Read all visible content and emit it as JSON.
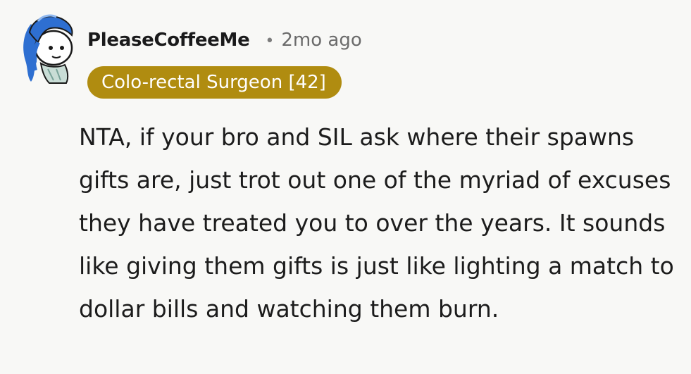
{
  "comment": {
    "username": "PleaseCoffeeMe",
    "separator": "•",
    "timestamp": "2mo ago",
    "flair": "Colo-rectal Surgeon [42]",
    "body": "NTA, if your bro and SIL ask where their spawns gifts are, just trot out one of the myriad of excuses they have treated you to over the years. It sounds like giving them gifts is just like lighting a match to dollar bills and watching them burn."
  },
  "colors": {
    "background": "#f8f8f6",
    "flair_background": "#b08c10",
    "avatar_hair": "#2e6fd1"
  },
  "icons": {
    "avatar": "user-avatar-blue-hair"
  }
}
